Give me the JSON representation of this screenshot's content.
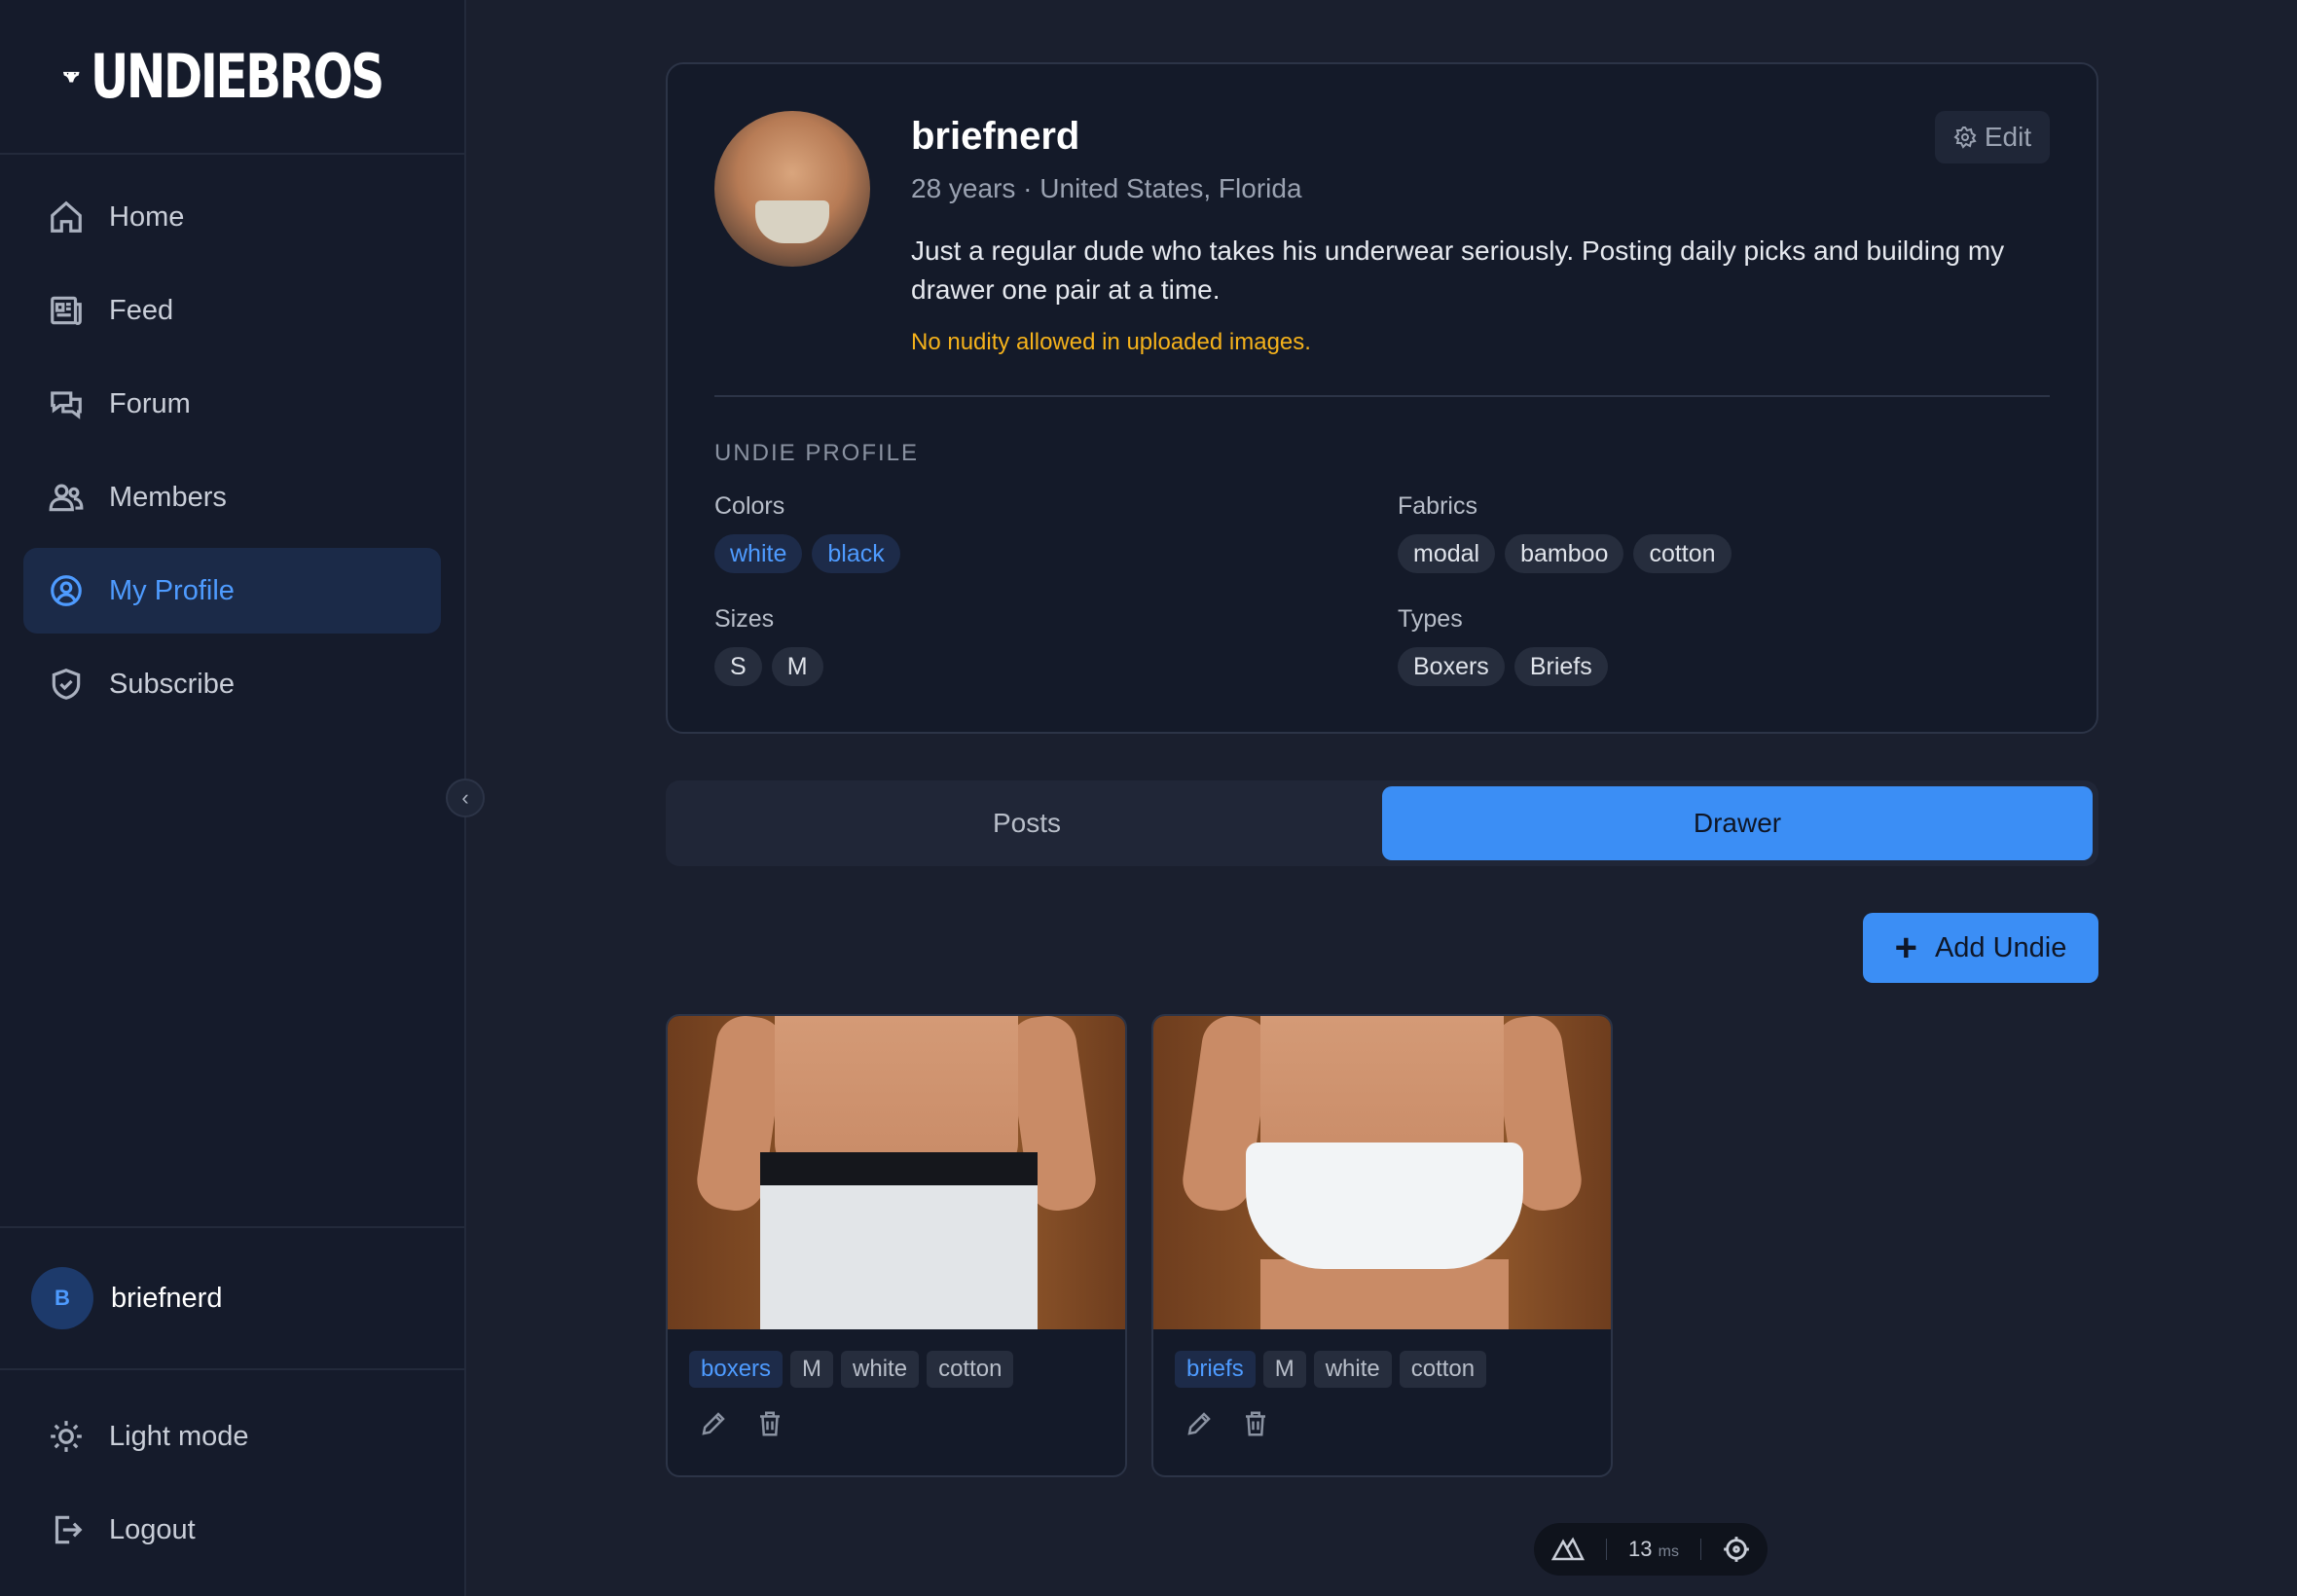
{
  "brand": {
    "name": "UNDIEBROS"
  },
  "sidebar": {
    "items": [
      {
        "label": "Home",
        "icon": "home-icon"
      },
      {
        "label": "Feed",
        "icon": "newspaper-icon"
      },
      {
        "label": "Forum",
        "icon": "chat-bubbles-icon"
      },
      {
        "label": "Members",
        "icon": "users-icon"
      },
      {
        "label": "My Profile",
        "icon": "user-circle-icon",
        "active": true
      },
      {
        "label": "Subscribe",
        "icon": "shield-check-icon"
      }
    ],
    "collapse_icon": "‹",
    "user": {
      "initial": "B",
      "name": "briefnerd"
    },
    "bottom": [
      {
        "label": "Light mode",
        "icon": "sun-icon"
      },
      {
        "label": "Logout",
        "icon": "logout-icon"
      }
    ]
  },
  "profile": {
    "username": "briefnerd",
    "meta": "28 years · United States, Florida",
    "bio": "Just a regular dude who takes his underwear seriously. Posting daily picks and building my drawer one pair at a time.",
    "warning": "No nudity allowed in uploaded images.",
    "edit_label": "Edit",
    "section_title": "UNDIE PROFILE",
    "colors": {
      "label": "Colors",
      "values": [
        "white",
        "black"
      ]
    },
    "fabrics": {
      "label": "Fabrics",
      "values": [
        "modal",
        "bamboo",
        "cotton"
      ]
    },
    "sizes": {
      "label": "Sizes",
      "values": [
        "S",
        "M"
      ]
    },
    "types": {
      "label": "Types",
      "values": [
        "Boxers",
        "Briefs"
      ]
    }
  },
  "tabs": [
    {
      "label": "Posts",
      "active": false
    },
    {
      "label": "Drawer",
      "active": true
    }
  ],
  "add_button": {
    "label": "Add Undie"
  },
  "drawer": [
    {
      "type": "boxers",
      "size": "M",
      "color": "white",
      "fabric": "cotton"
    },
    {
      "type": "briefs",
      "size": "M",
      "color": "white",
      "fabric": "cotton"
    }
  ],
  "devtools": {
    "value": "13",
    "unit": "ms"
  },
  "colors": {
    "accent": "#3b8ef5",
    "background": "#1a1f2e",
    "sidebar": "#151b2b",
    "warning": "#f5b21b"
  }
}
